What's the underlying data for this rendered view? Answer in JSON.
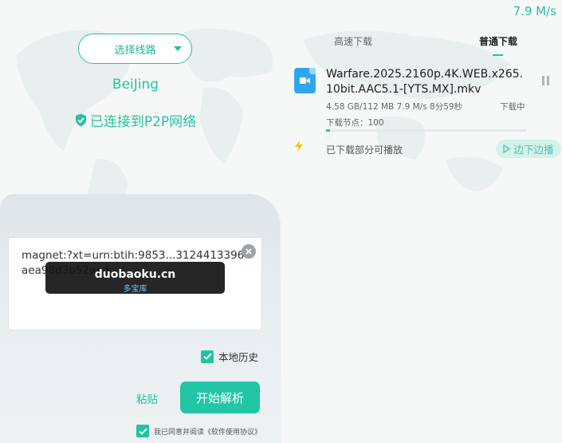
{
  "speed_top": "7.9 M/s",
  "route": {
    "label": "选择线路"
  },
  "city": "BeiJing",
  "connection_status": "已连接到P2P网络",
  "magnet": {
    "value": "magnet:?xt=urn:btih:9853...3124413396aea98d3b52aed"
  },
  "watermark": {
    "line1": "duobaoku.cn",
    "line2": "多宝库"
  },
  "history": {
    "label": "本地历史",
    "checked": true
  },
  "actions": {
    "paste": "粘贴",
    "parse": "开始解析"
  },
  "agreement": {
    "label": "我已同意并阅读《软件使用协议》",
    "checked": true
  },
  "tabs": [
    {
      "label": "高速下载",
      "active": false
    },
    {
      "label": "普通下载",
      "active": true
    }
  ],
  "download": {
    "file_name": "Warfare.2025.2160p.4K.WEB.x265.10bit.AAC5.1-[YTS.MX].mkv",
    "meta": "4.58 GB/112 MB  7.9 M/s  8分59秒",
    "status": "下载中",
    "nodes": "下载节点：100",
    "progress": 0.02,
    "partial_play": "已下载部分可播放",
    "edge_play": "边下边播"
  },
  "colors": {
    "accent": "#23c2a1",
    "file_icon": "#2fa6f2"
  }
}
